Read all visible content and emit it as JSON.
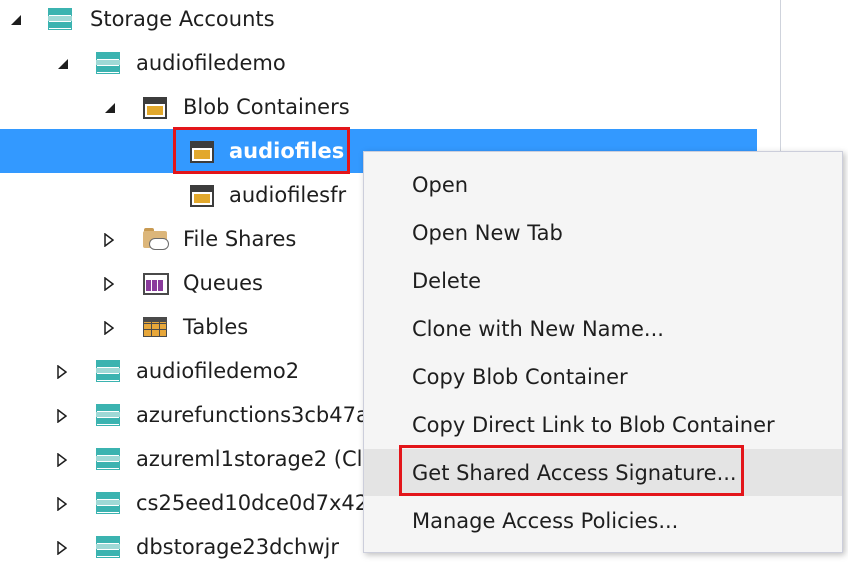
{
  "tree": {
    "root": {
      "label": "Storage Accounts",
      "expanded": true
    },
    "account": {
      "label": "audiofiledemo",
      "expanded": true
    },
    "blob_containers": {
      "label": "Blob Containers",
      "expanded": true
    },
    "containers": [
      {
        "label": "audiofiles",
        "selected": true
      },
      {
        "label": "audiofilesfr",
        "selected": false
      }
    ],
    "services": [
      {
        "label": "File Shares",
        "icon": "file-share-icon"
      },
      {
        "label": "Queues",
        "icon": "queues-icon"
      },
      {
        "label": "Tables",
        "icon": "tables-icon"
      }
    ],
    "other_accounts": [
      {
        "label": "audiofiledemo2"
      },
      {
        "label": "azurefunctions3cb47a"
      },
      {
        "label": "azureml1storage2 (Cl"
      },
      {
        "label": "cs25eed10dce0d7x42"
      },
      {
        "label": "dbstorage23dchwjr"
      }
    ]
  },
  "context_menu": {
    "items": [
      {
        "label": "Open"
      },
      {
        "label": "Open New Tab"
      },
      {
        "label": "Delete"
      },
      {
        "label": "Clone with New Name..."
      },
      {
        "label": "Copy Blob Container"
      },
      {
        "label": "Copy Direct Link to Blob Container"
      },
      {
        "label": "Get Shared Access Signature...",
        "hovered": true
      },
      {
        "label": "Manage Access Policies..."
      }
    ]
  },
  "colors": {
    "selection": "#3399ff",
    "highlight_box": "#e3151a",
    "menu_background": "#f5f5f5",
    "menu_hover": "#e4e4e4"
  }
}
